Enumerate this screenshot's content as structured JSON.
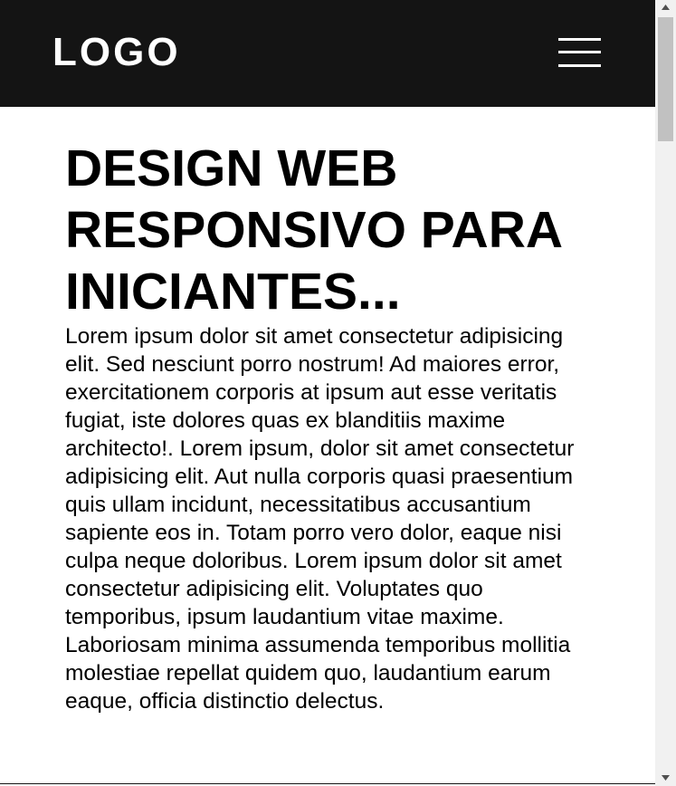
{
  "header": {
    "logo_text": "LOGO",
    "menu_icon": "hamburger-menu-icon"
  },
  "main": {
    "title": "DESIGN WEB RESPONSIVO PARA INICIANTES...",
    "body": "Lorem ipsum dolor sit amet consectetur adipisicing elit. Sed nesciunt porro nostrum! Ad maiores error, exercitationem corporis at ipsum aut esse veritatis fugiat, iste dolores quas ex blanditiis maxime architecto!. Lorem ipsum, dolor sit amet consectetur adipisicing elit. Aut nulla corporis quasi praesentium quis ullam incidunt, necessitatibus accusantium sapiente eos in. Totam porro vero dolor, eaque nisi culpa neque doloribus. Lorem ipsum dolor sit amet consectetur adipisicing elit. Voluptates quo temporibus, ipsum laudantium vitae maxime. Laboriosam minima assumenda temporibus mollitia molestiae repellat quidem quo, laudantium earum eaque, officia distinctio delectus."
  },
  "colors": {
    "header_background": "#141414",
    "header_text": "#ffffff",
    "page_background": "#ffffff",
    "body_text": "#000000",
    "scrollbar_track": "#f1f1f1",
    "scrollbar_thumb": "#c1c1c1"
  },
  "scrollbar": {
    "up_icon": "scroll-up-arrow-icon",
    "down_icon": "scroll-down-arrow-icon"
  }
}
